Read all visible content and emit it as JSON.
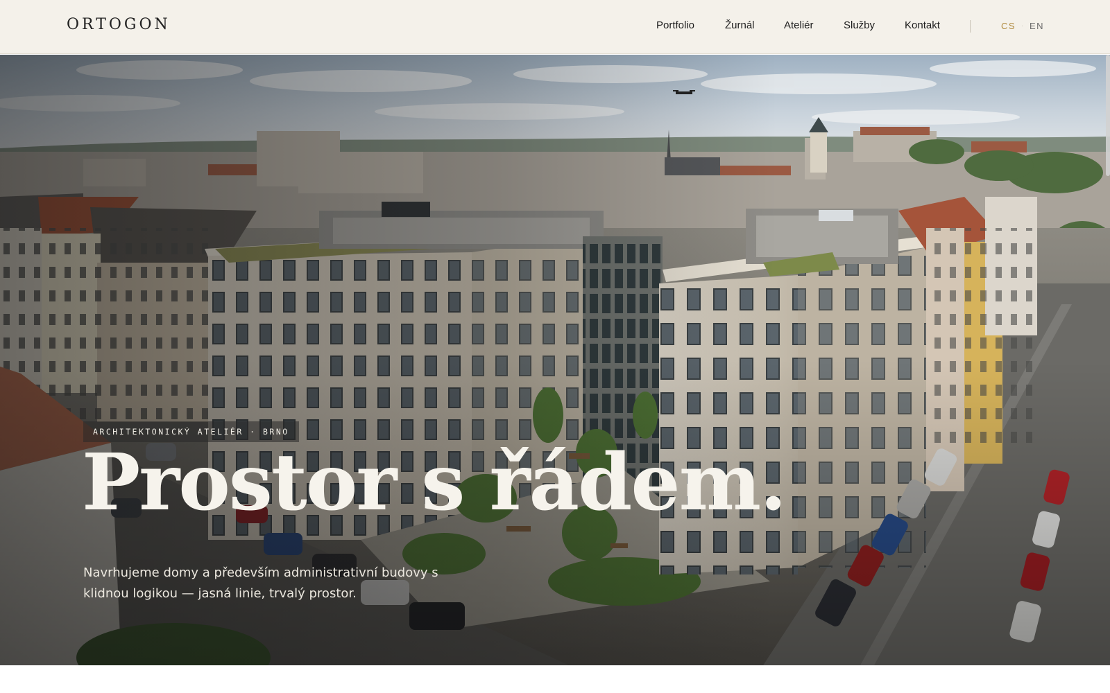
{
  "header": {
    "logo": "ORTOGON",
    "nav": [
      {
        "label": "Portfolio"
      },
      {
        "label": "Žurnál"
      },
      {
        "label": "Ateliér"
      },
      {
        "label": "Služby"
      },
      {
        "label": "Kontakt"
      }
    ],
    "lang": {
      "active": "CS",
      "separator": "·",
      "other": "EN"
    }
  },
  "hero": {
    "eyebrow": "ARCHITEKTONICKÝ ATELIÉR · BRNO",
    "headline": "Prostor s řádem.",
    "subline": "Navrhujeme domy a především administrativní budovy s klidnou logikou — jasná linie, trvalý prostor."
  },
  "colors": {
    "header_bg": "#f4f1ea",
    "accent": "#b08a3e",
    "text_dark": "#1d1d1d",
    "hero_text": "#f6f3ec"
  }
}
